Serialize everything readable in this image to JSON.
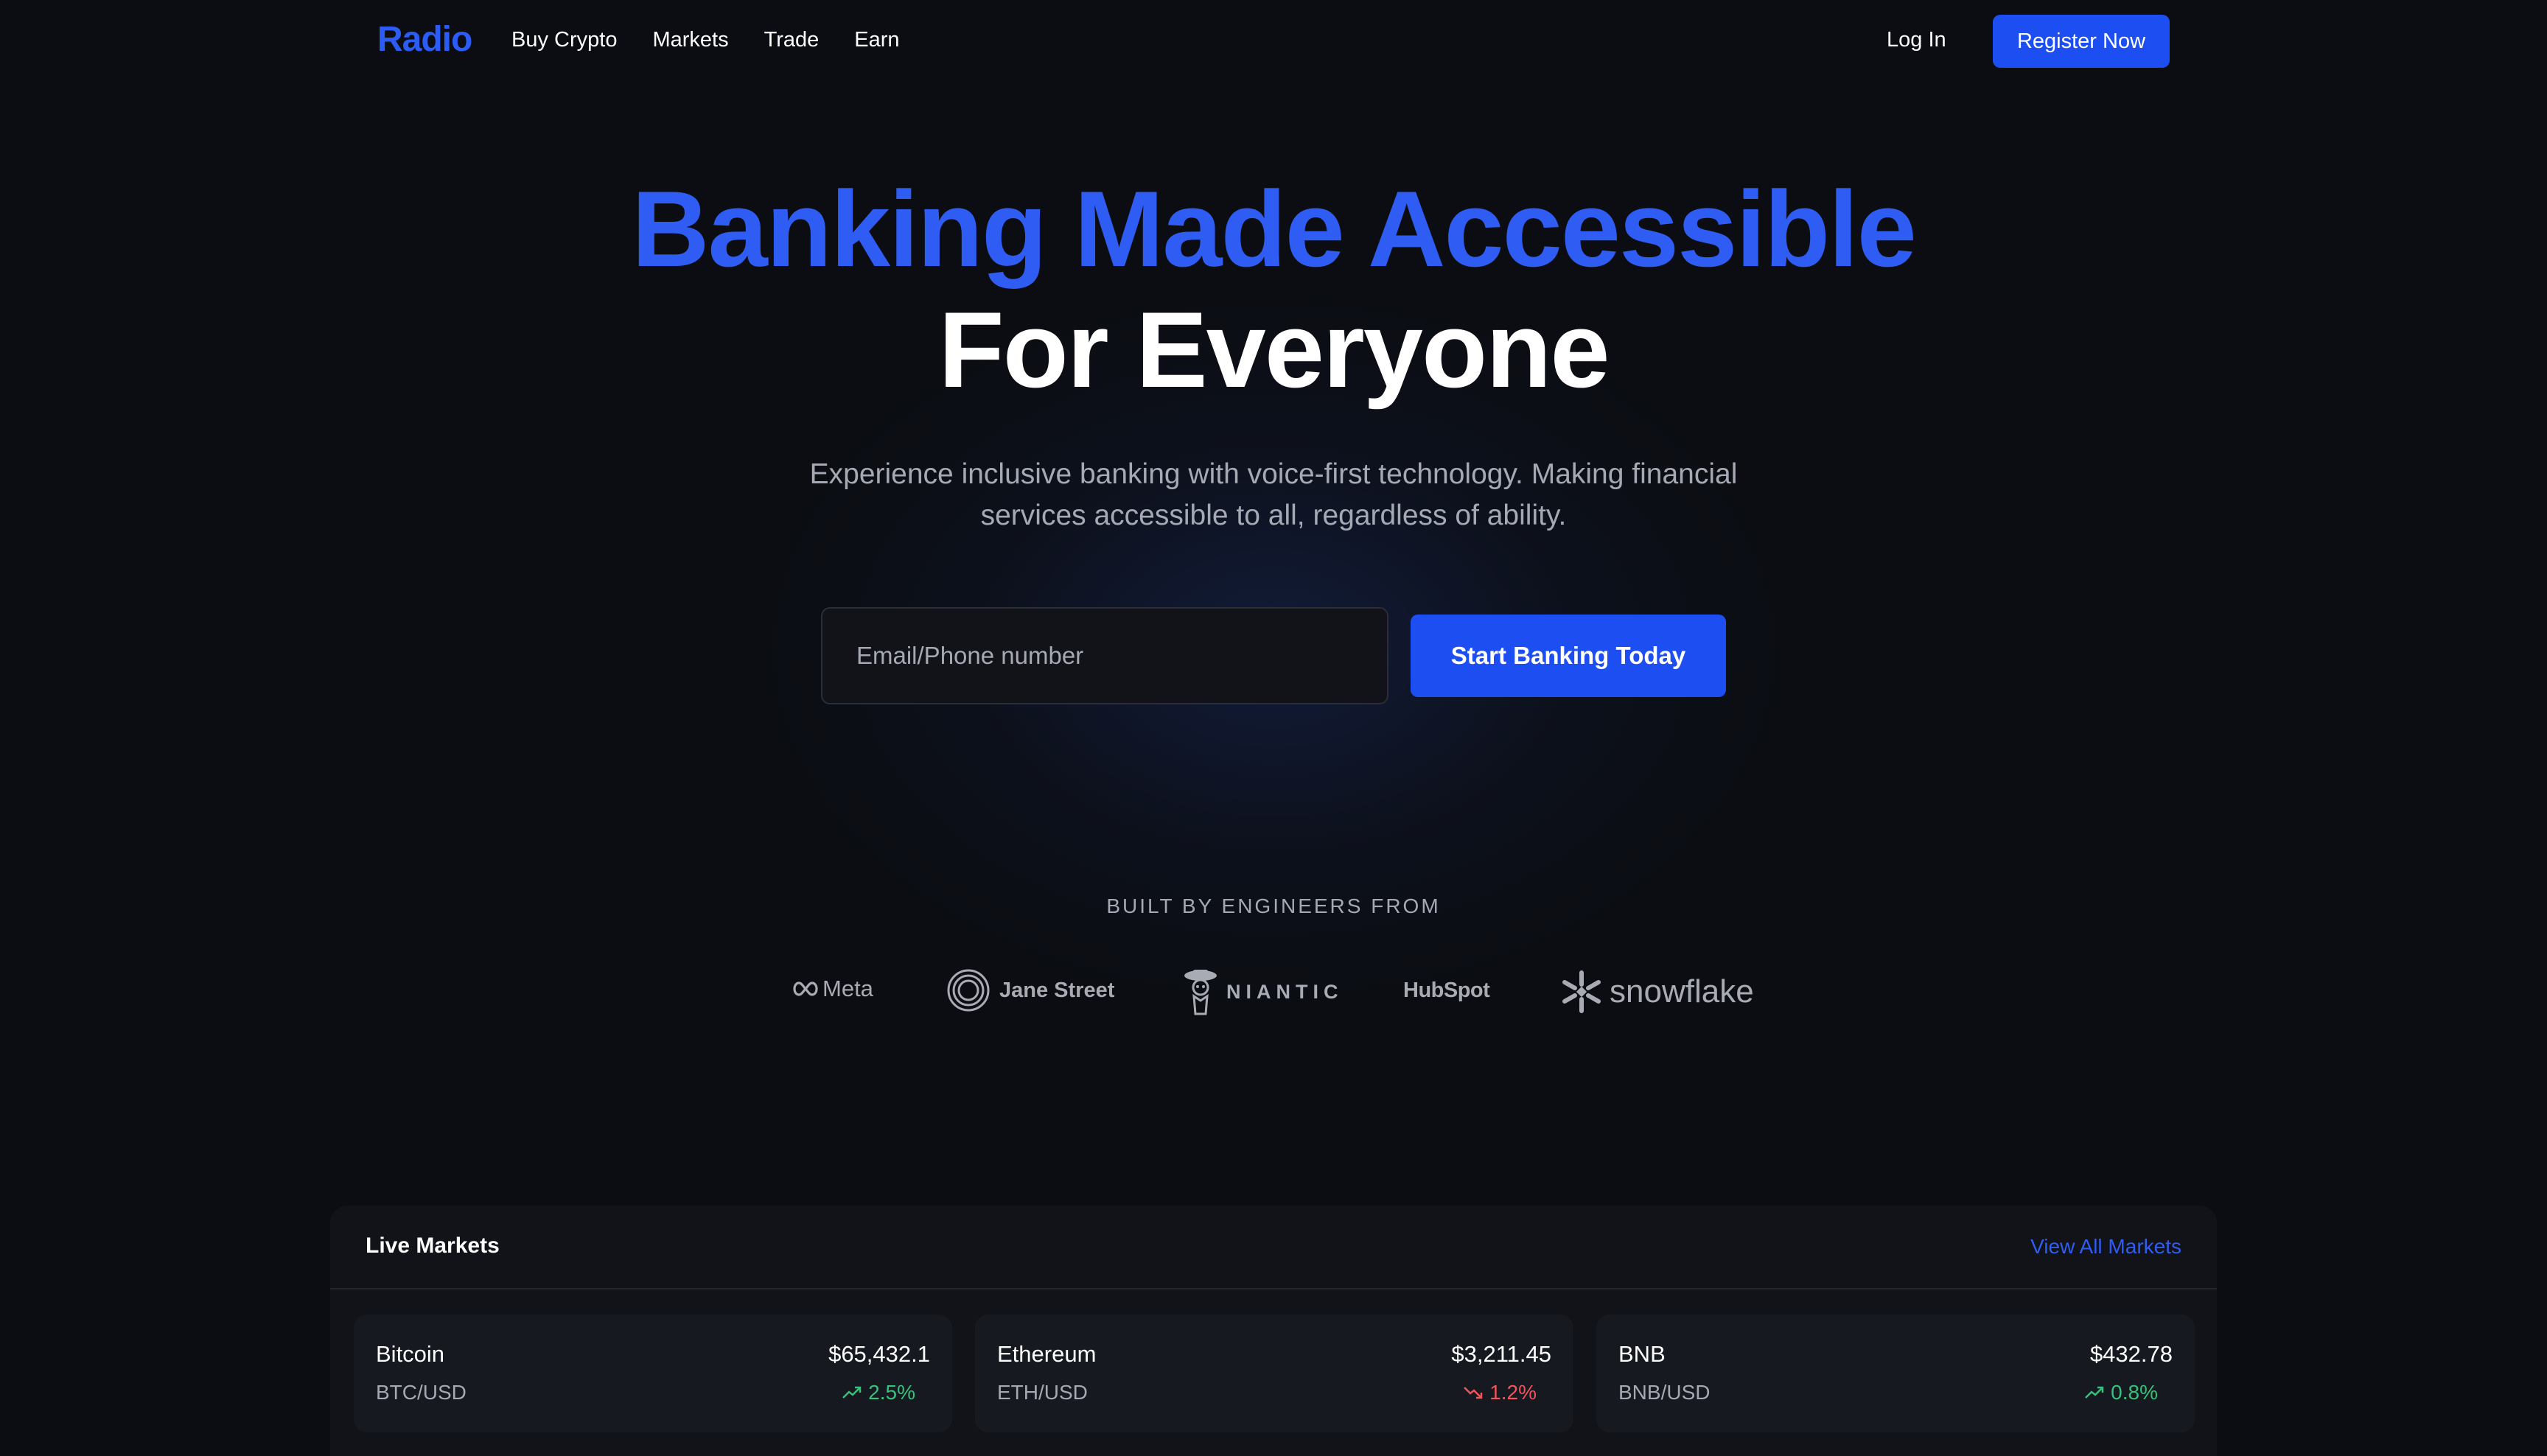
{
  "nav": {
    "logo": "Radio",
    "links": [
      "Buy Crypto",
      "Markets",
      "Trade",
      "Earn"
    ],
    "login": "Log In",
    "register": "Register Now"
  },
  "hero": {
    "title_line1": "Banking Made Accessible",
    "title_line2": "For Everyone",
    "subtitle": "Experience inclusive banking with voice-first technology. Making financial services accessible to all, regardless of ability.",
    "email_placeholder": "Email/Phone number",
    "cta": "Start Banking Today"
  },
  "built_by": {
    "heading": "BUILT BY ENGINEERS FROM",
    "companies": [
      "Meta",
      "Jane Street",
      "NIANTIC",
      "HubSpot",
      "snowflake"
    ]
  },
  "markets": {
    "title": "Live Markets",
    "view_all": "View All Markets",
    "items": [
      {
        "name": "Bitcoin",
        "pair": "BTC/USD",
        "price": "$65,432.1",
        "change": "2.5%",
        "direction": "up"
      },
      {
        "name": "Ethereum",
        "pair": "ETH/USD",
        "price": "$3,211.45",
        "change": "1.2%",
        "direction": "down"
      },
      {
        "name": "BNB",
        "pair": "BNB/USD",
        "price": "$432.78",
        "change": "0.8%",
        "direction": "up"
      }
    ]
  },
  "colors": {
    "accent": "#1d4ef2",
    "accent_text": "#2f5cf2",
    "background": "#0b0d12",
    "positive": "#35c27a",
    "negative": "#f0555e"
  }
}
